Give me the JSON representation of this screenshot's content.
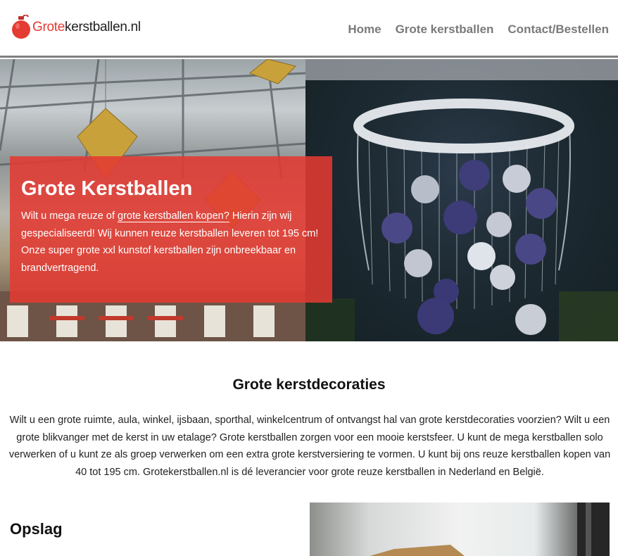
{
  "header": {
    "logo": {
      "prefix": "Grote",
      "suffix": "kerstballen.nl"
    },
    "nav": [
      "Home",
      "Grote kerstballen",
      "Contact/Bestellen"
    ]
  },
  "hero": {
    "title": "Grote Kerstballen",
    "text_before_link": "Wilt u mega reuze of ",
    "link": "grote kerstballen kopen?",
    "text_after_link": " Hierin zijn wij gespecialiseerd! Wij kunnen reuze kerstballen leveren tot 195 cm! Onze super grote xxl kunstof kerstballen zijn onbreekbaar en brandvertragend."
  },
  "section": {
    "title": "Grote kerstdecoraties",
    "text": "Wilt u een grote ruimte, aula, winkel, ijsbaan, sporthal, winkelcentrum of ontvangst hal van grote kerstdecoraties voorzien? Wilt u een grote blikvanger met de kerst in uw etalage? Grote kerstballen zorgen voor een mooie kerstsfeer. U kunt de mega kerstballen solo verwerken of u kunt ze als groep verwerken om een extra grote kerstversiering te vormen. U kunt bij ons reuze kerstballen kopen van 40 tot 195 cm. Grotekerstballen.nl is dé leverancier voor grote reuze kerstballen in Nederland en België."
  },
  "opslag": {
    "title": "Opslag"
  },
  "colors": {
    "accent": "#e43b33",
    "nav": "#7a7a7a",
    "card": "#e23a32"
  }
}
